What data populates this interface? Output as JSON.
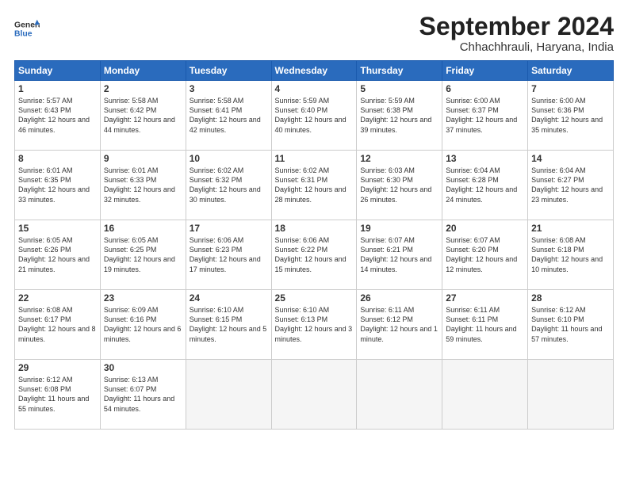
{
  "header": {
    "logo_line1": "General",
    "logo_line2": "Blue",
    "month": "September 2024",
    "location": "Chhachhrauli, Haryana, India"
  },
  "weekdays": [
    "Sunday",
    "Monday",
    "Tuesday",
    "Wednesday",
    "Thursday",
    "Friday",
    "Saturday"
  ],
  "weeks": [
    [
      {
        "day": "1",
        "sr": "5:57 AM",
        "ss": "6:43 PM",
        "dl": "12 hours and 46 minutes."
      },
      {
        "day": "2",
        "sr": "5:58 AM",
        "ss": "6:42 PM",
        "dl": "12 hours and 44 minutes."
      },
      {
        "day": "3",
        "sr": "5:58 AM",
        "ss": "6:41 PM",
        "dl": "12 hours and 42 minutes."
      },
      {
        "day": "4",
        "sr": "5:59 AM",
        "ss": "6:40 PM",
        "dl": "12 hours and 40 minutes."
      },
      {
        "day": "5",
        "sr": "5:59 AM",
        "ss": "6:38 PM",
        "dl": "12 hours and 39 minutes."
      },
      {
        "day": "6",
        "sr": "6:00 AM",
        "ss": "6:37 PM",
        "dl": "12 hours and 37 minutes."
      },
      {
        "day": "7",
        "sr": "6:00 AM",
        "ss": "6:36 PM",
        "dl": "12 hours and 35 minutes."
      }
    ],
    [
      {
        "day": "8",
        "sr": "6:01 AM",
        "ss": "6:35 PM",
        "dl": "12 hours and 33 minutes."
      },
      {
        "day": "9",
        "sr": "6:01 AM",
        "ss": "6:33 PM",
        "dl": "12 hours and 32 minutes."
      },
      {
        "day": "10",
        "sr": "6:02 AM",
        "ss": "6:32 PM",
        "dl": "12 hours and 30 minutes."
      },
      {
        "day": "11",
        "sr": "6:02 AM",
        "ss": "6:31 PM",
        "dl": "12 hours and 28 minutes."
      },
      {
        "day": "12",
        "sr": "6:03 AM",
        "ss": "6:30 PM",
        "dl": "12 hours and 26 minutes."
      },
      {
        "day": "13",
        "sr": "6:04 AM",
        "ss": "6:28 PM",
        "dl": "12 hours and 24 minutes."
      },
      {
        "day": "14",
        "sr": "6:04 AM",
        "ss": "6:27 PM",
        "dl": "12 hours and 23 minutes."
      }
    ],
    [
      {
        "day": "15",
        "sr": "6:05 AM",
        "ss": "6:26 PM",
        "dl": "12 hours and 21 minutes."
      },
      {
        "day": "16",
        "sr": "6:05 AM",
        "ss": "6:25 PM",
        "dl": "12 hours and 19 minutes."
      },
      {
        "day": "17",
        "sr": "6:06 AM",
        "ss": "6:23 PM",
        "dl": "12 hours and 17 minutes."
      },
      {
        "day": "18",
        "sr": "6:06 AM",
        "ss": "6:22 PM",
        "dl": "12 hours and 15 minutes."
      },
      {
        "day": "19",
        "sr": "6:07 AM",
        "ss": "6:21 PM",
        "dl": "12 hours and 14 minutes."
      },
      {
        "day": "20",
        "sr": "6:07 AM",
        "ss": "6:20 PM",
        "dl": "12 hours and 12 minutes."
      },
      {
        "day": "21",
        "sr": "6:08 AM",
        "ss": "6:18 PM",
        "dl": "12 hours and 10 minutes."
      }
    ],
    [
      {
        "day": "22",
        "sr": "6:08 AM",
        "ss": "6:17 PM",
        "dl": "12 hours and 8 minutes."
      },
      {
        "day": "23",
        "sr": "6:09 AM",
        "ss": "6:16 PM",
        "dl": "12 hours and 6 minutes."
      },
      {
        "day": "24",
        "sr": "6:10 AM",
        "ss": "6:15 PM",
        "dl": "12 hours and 5 minutes."
      },
      {
        "day": "25",
        "sr": "6:10 AM",
        "ss": "6:13 PM",
        "dl": "12 hours and 3 minutes."
      },
      {
        "day": "26",
        "sr": "6:11 AM",
        "ss": "6:12 PM",
        "dl": "12 hours and 1 minute."
      },
      {
        "day": "27",
        "sr": "6:11 AM",
        "ss": "6:11 PM",
        "dl": "11 hours and 59 minutes."
      },
      {
        "day": "28",
        "sr": "6:12 AM",
        "ss": "6:10 PM",
        "dl": "11 hours and 57 minutes."
      }
    ],
    [
      {
        "day": "29",
        "sr": "6:12 AM",
        "ss": "6:08 PM",
        "dl": "11 hours and 55 minutes."
      },
      {
        "day": "30",
        "sr": "6:13 AM",
        "ss": "6:07 PM",
        "dl": "11 hours and 54 minutes."
      },
      null,
      null,
      null,
      null,
      null
    ]
  ]
}
